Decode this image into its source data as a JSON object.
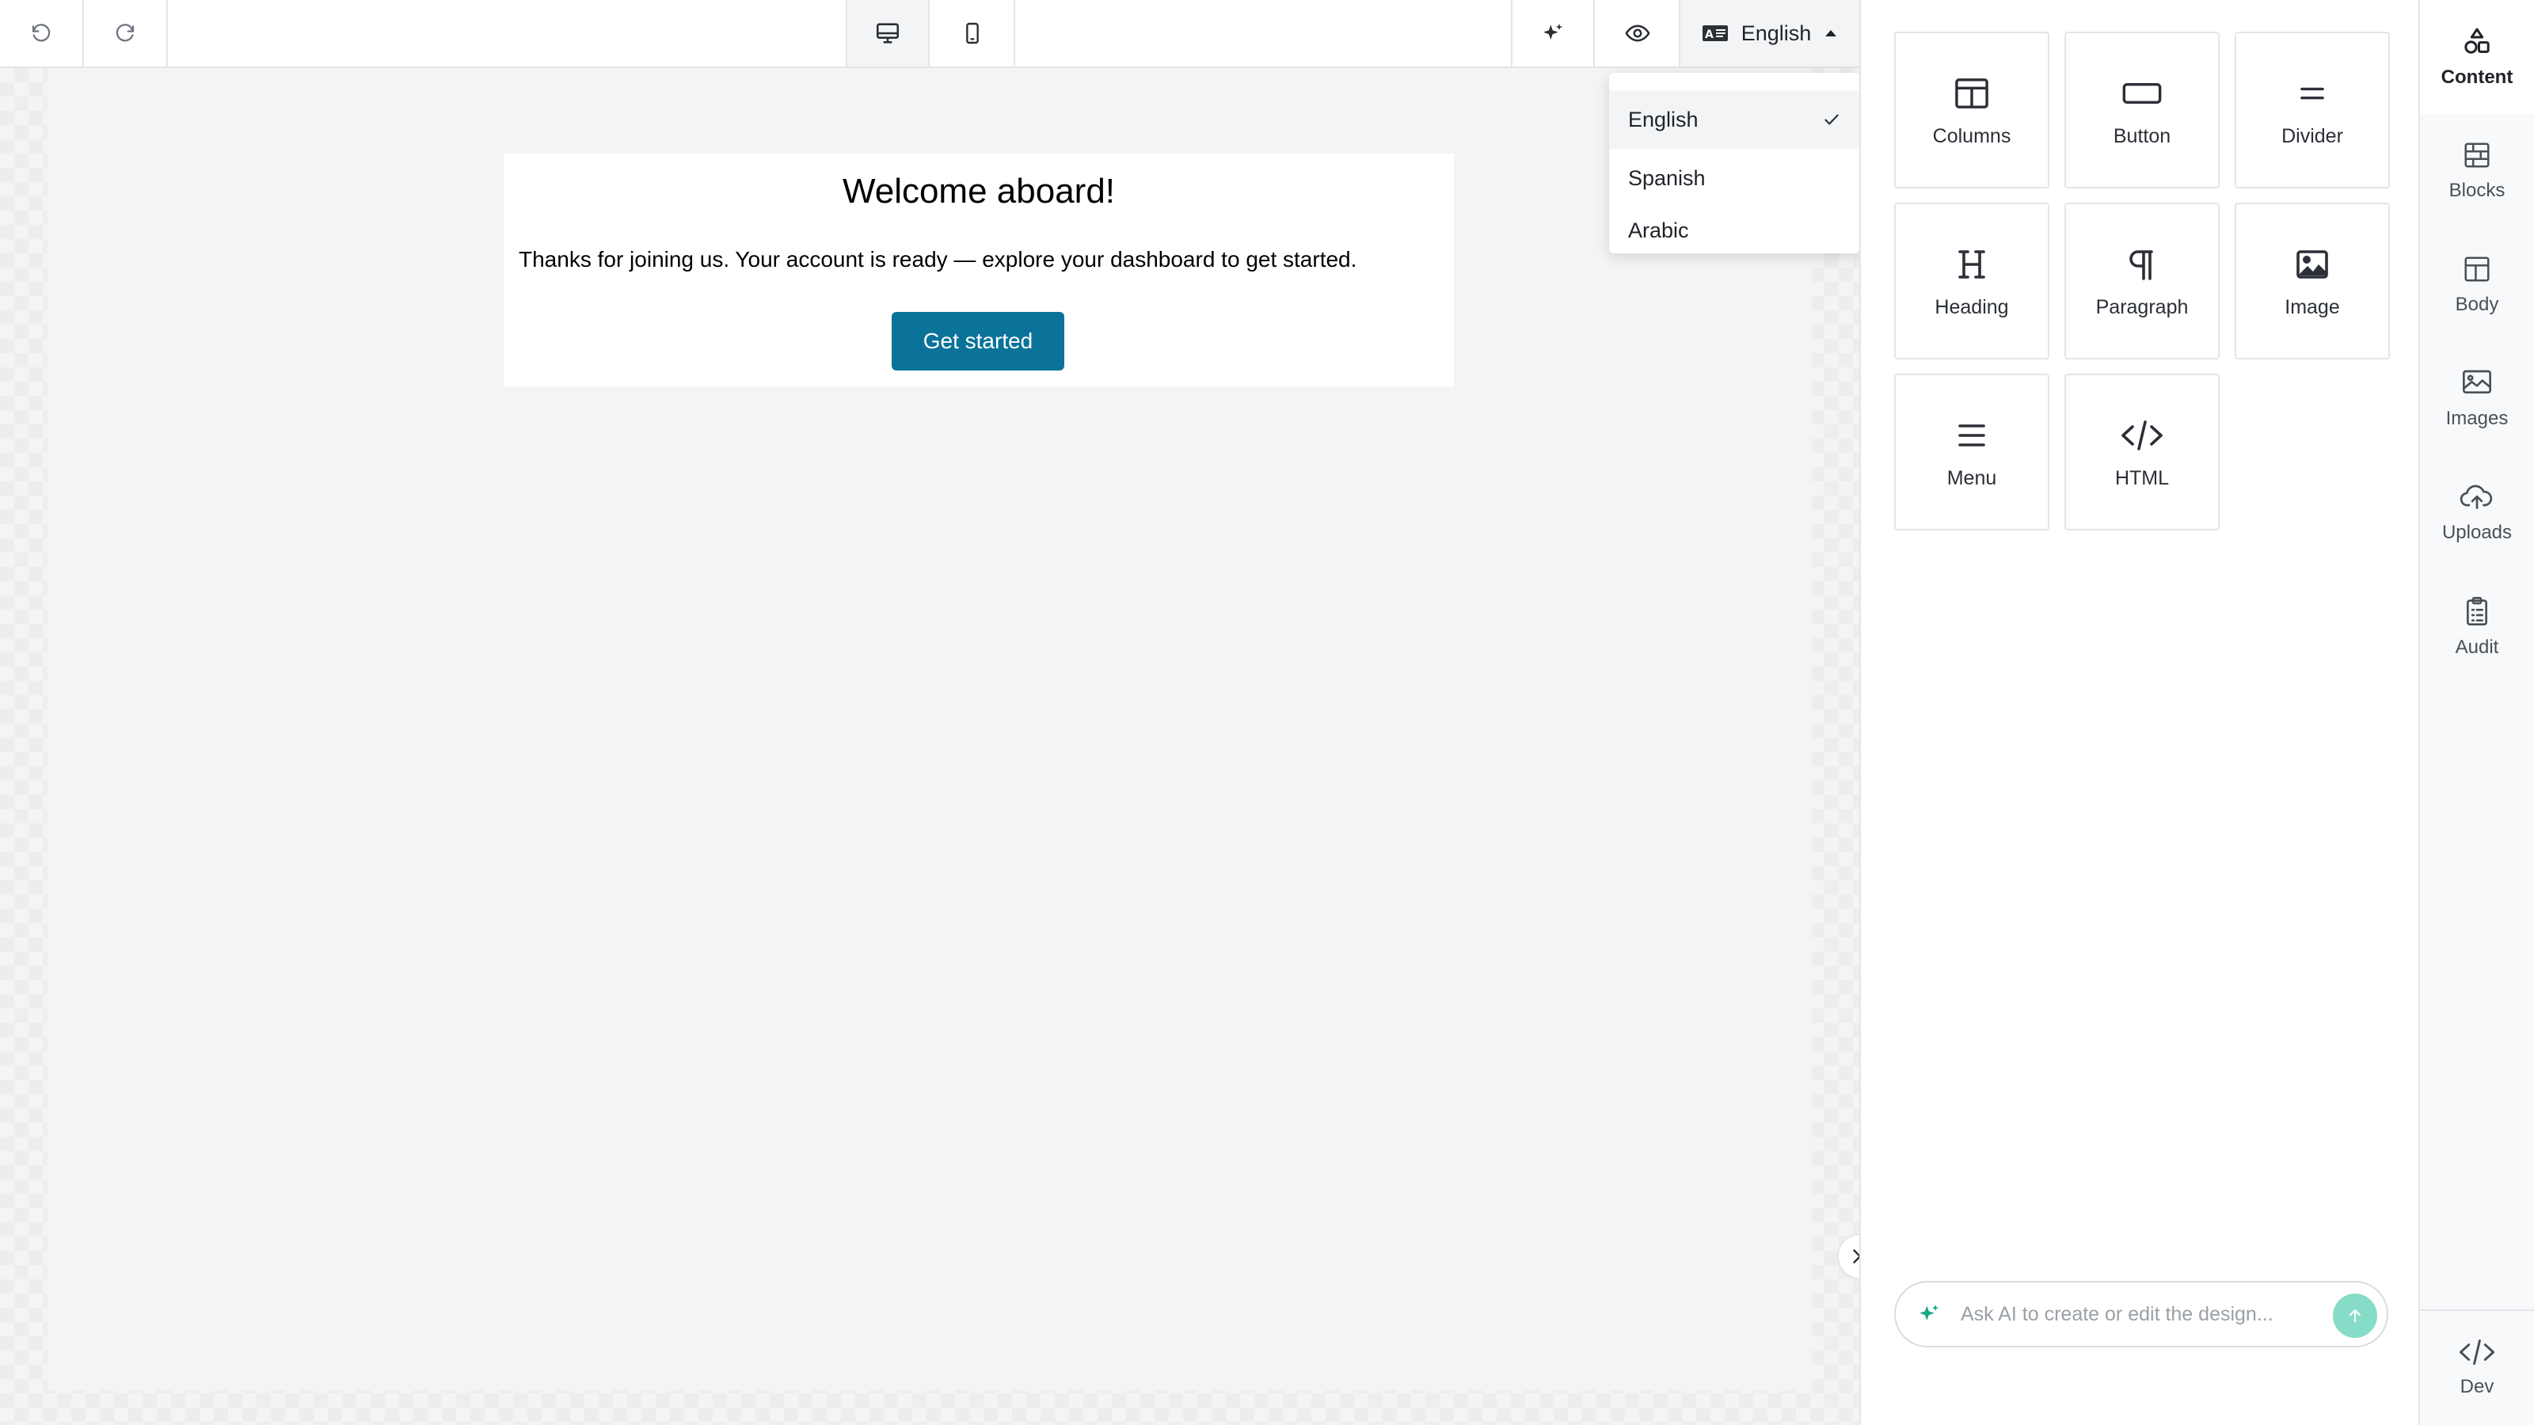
{
  "toolbar": {
    "language_selected": "English"
  },
  "language_menu": {
    "options": [
      "English",
      "Spanish",
      "Arabic"
    ],
    "selected_index": 0
  },
  "email": {
    "title": "Welcome aboard!",
    "body": "Thanks for joining us. Your account is ready — explore your dashboard to get started.",
    "cta": "Get started",
    "cta_color": "#0b7399"
  },
  "content_tiles": [
    {
      "label": "Columns",
      "icon": "columns-icon"
    },
    {
      "label": "Button",
      "icon": "button-icon"
    },
    {
      "label": "Divider",
      "icon": "divider-icon"
    },
    {
      "label": "Heading",
      "icon": "heading-icon"
    },
    {
      "label": "Paragraph",
      "icon": "paragraph-icon"
    },
    {
      "label": "Image",
      "icon": "image-icon"
    },
    {
      "label": "Menu",
      "icon": "menu-icon"
    },
    {
      "label": "HTML",
      "icon": "code-icon"
    }
  ],
  "ai": {
    "placeholder": "Ask AI to create or edit the design...",
    "accent": "#86dcc6"
  },
  "sidebar": {
    "items": [
      {
        "label": "Content",
        "icon": "shapes-icon",
        "active": true
      },
      {
        "label": "Blocks",
        "icon": "blocks-icon"
      },
      {
        "label": "Body",
        "icon": "layout-icon"
      },
      {
        "label": "Images",
        "icon": "images-icon"
      },
      {
        "label": "Uploads",
        "icon": "cloud-upload-icon"
      },
      {
        "label": "Audit",
        "icon": "clipboard-icon"
      }
    ],
    "bottom": {
      "label": "Dev",
      "icon": "code-icon"
    }
  }
}
